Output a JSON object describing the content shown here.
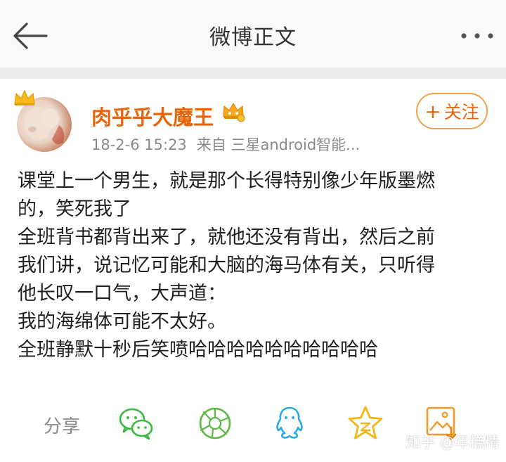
{
  "header": {
    "title": "微博正文",
    "back_icon": "arrow-left-icon",
    "more_icon": "more-dots-icon"
  },
  "post": {
    "author": {
      "name": "肉乎乎大魔王",
      "avatar_badge": "crown-icon",
      "vip_badge": "vip-crown-icon"
    },
    "time": "18-2-6 15:23",
    "source": "来自 三星android智能...",
    "follow_label": "关注",
    "follow_prefix": "+",
    "lines": [
      "课堂上一个男生，就是那个长得特别像少年版墨燃",
      "的，笑死我了",
      "全班背书都背出来了，就他还没有背出，然后之前",
      "我们讲，说记忆可能和大脑的海马体有关，只听得",
      "他长叹一口气，大声道：",
      "我的海绵体可能不太好。",
      "全班静默十秒后笑喷哈哈哈哈哈哈哈哈哈哈"
    ]
  },
  "share": {
    "label": "分享",
    "targets": [
      {
        "name": "wechat",
        "icon": "wechat-icon",
        "color": "#3bb83f"
      },
      {
        "name": "moments",
        "icon": "wechat-moments-icon",
        "color": "#5fb946"
      },
      {
        "name": "qq",
        "icon": "qq-icon",
        "color": "#2fa8e6"
      },
      {
        "name": "qzone",
        "icon": "qzone-star-icon",
        "color": "#f5b615"
      },
      {
        "name": "save-image",
        "icon": "save-image-icon",
        "color": "#f09a2a"
      }
    ]
  },
  "watermark": "知乎 @年糕精",
  "colors": {
    "accent": "#e8640b",
    "meta": "#8a8a8a",
    "header_bg": "#f9f9f9",
    "divider": "#ececec"
  }
}
